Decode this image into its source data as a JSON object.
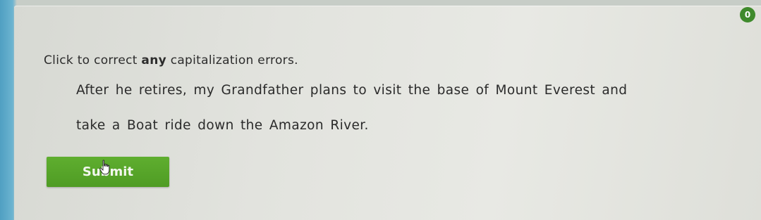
{
  "help": {
    "label": "0"
  },
  "instruction": {
    "before": "Click to correct ",
    "emphasis": "any",
    "after": " capitalization errors."
  },
  "sentence": {
    "words": [
      "After",
      "he",
      "retires,",
      "my",
      "Grandfather",
      "plans",
      "to",
      "visit",
      "the",
      "base",
      "of",
      "Mount",
      "Everest",
      "and",
      "take",
      "a",
      "Boat",
      "ride",
      "down",
      "the",
      "Amazon",
      "River."
    ]
  },
  "submit": {
    "label": "Submit"
  },
  "colors": {
    "accent": "#4f9c24",
    "panel": "#e2e3de",
    "backdrop": "#5aa9c9"
  },
  "icons": {
    "cursor": "hand-pointer-icon"
  }
}
